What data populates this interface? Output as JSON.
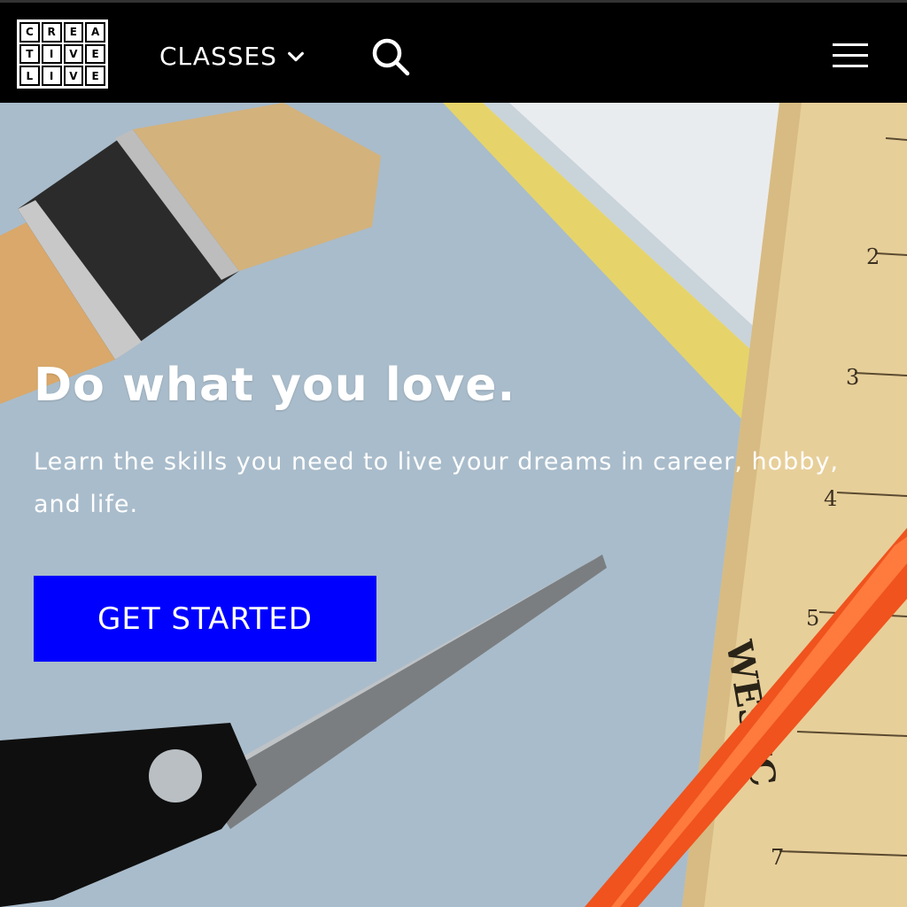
{
  "header": {
    "logo_letters": [
      "C",
      "R",
      "E",
      "A",
      "T",
      "I",
      "V",
      "E",
      "L",
      "I",
      "V",
      "E"
    ],
    "nav_classes_label": "CLASSES",
    "icons": {
      "chevron": "chevron-down-icon",
      "search": "search-icon",
      "menu": "hamburger-menu-icon"
    }
  },
  "hero": {
    "headline": "Do what you love.",
    "subtext": "Learn the skills you need to live your dreams in career, hobby, and life.",
    "cta_label": "GET STARTED",
    "background_description_colors": {
      "paper": "#a9bccb",
      "yellow_strip": "#e6d46a",
      "ruler": "#e7cf9a",
      "orange_tool": "#f0531d",
      "brush_bristles": "#d3b27c",
      "cta": "#0000ff"
    }
  }
}
